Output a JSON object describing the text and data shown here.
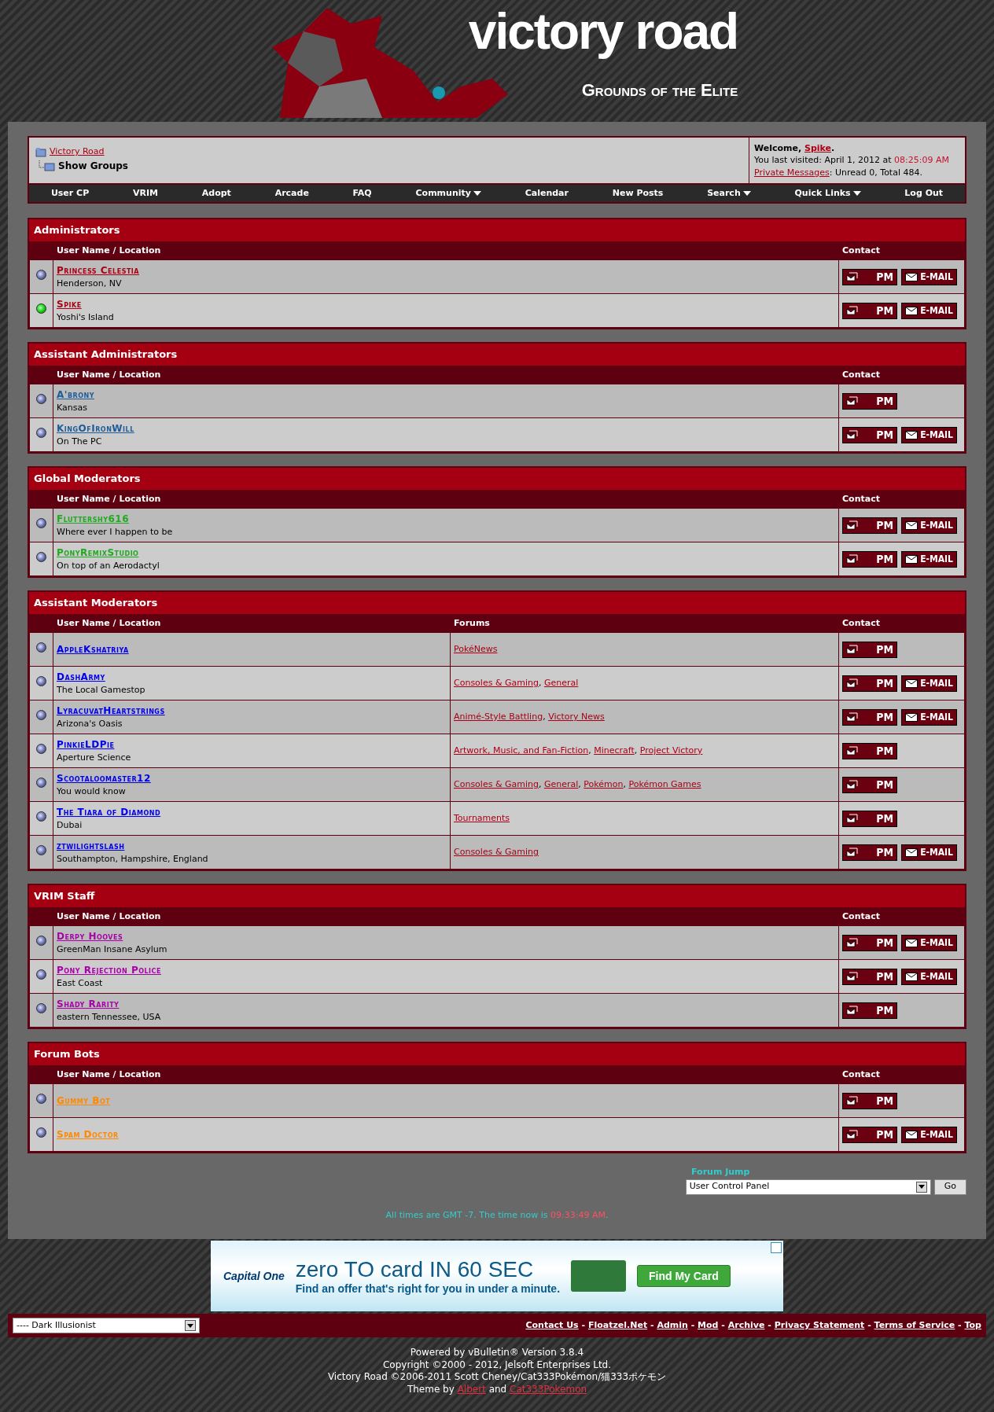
{
  "logo": {
    "title": "victory road",
    "subtitle": "Grounds of the Elite"
  },
  "breadcrumb": {
    "parent": "Victory Road",
    "current": "Show Groups"
  },
  "welcome": {
    "label": "Welcome,",
    "username": "Spike",
    "end": ".",
    "last_visited_label": "You last visited: April 1, 2012 at",
    "last_visited_time": "08:25:09 AM",
    "pm_link": "Private Messages",
    "pm_counts": ": Unread 0, Total 484."
  },
  "navbar": [
    {
      "label": "User CP",
      "menu": false
    },
    {
      "label": "VRIM",
      "menu": false
    },
    {
      "label": "Adopt",
      "menu": false
    },
    {
      "label": "Arcade",
      "menu": false
    },
    {
      "label": "FAQ",
      "menu": false
    },
    {
      "label": "Community",
      "menu": true
    },
    {
      "label": "Calendar",
      "menu": false
    },
    {
      "label": "New Posts",
      "menu": false
    },
    {
      "label": "Search",
      "menu": true
    },
    {
      "label": "Quick Links",
      "menu": true
    },
    {
      "label": "Log Out",
      "menu": false
    }
  ],
  "list_separator": ", ",
  "groups": [
    {
      "title": "Administrators",
      "color": "#aa0014",
      "columns": [
        "User Name / Location",
        "Contact"
      ],
      "members": [
        {
          "name": "Princess Celestia",
          "location": "Henderson, NV",
          "online": false,
          "contact": [
            {
              "kind": "pm",
              "label": "PM"
            },
            {
              "kind": "email",
              "label": "E-MAIL"
            }
          ]
        },
        {
          "name": "Spike",
          "location": "Yoshi's Island",
          "online": true,
          "contact": [
            {
              "kind": "pm",
              "label": "PM"
            },
            {
              "kind": "email",
              "label": "E-MAIL"
            }
          ]
        }
      ]
    },
    {
      "title": "Assistant Administrators",
      "color": "#1f5c99",
      "columns": [
        "User Name / Location",
        "Contact"
      ],
      "members": [
        {
          "name": "A'brony",
          "location": "Kansas",
          "online": false,
          "contact": [
            {
              "kind": "pm",
              "label": "PM"
            }
          ]
        },
        {
          "name": "KingOfIronWill",
          "location": "On The PC",
          "online": false,
          "contact": [
            {
              "kind": "pm",
              "label": "PM"
            },
            {
              "kind": "email",
              "label": "E-MAIL"
            }
          ]
        }
      ]
    },
    {
      "title": "Global Moderators",
      "color": "#1faa1f",
      "columns": [
        "User Name / Location",
        "Contact"
      ],
      "members": [
        {
          "name": "Fluttershy616",
          "location": "Where ever I happen to be",
          "online": false,
          "contact": [
            {
              "kind": "pm",
              "label": "PM"
            },
            {
              "kind": "email",
              "label": "E-MAIL"
            }
          ]
        },
        {
          "name": "PonyRemixStudio",
          "location": "On top of an Aerodactyl",
          "online": false,
          "contact": [
            {
              "kind": "pm",
              "label": "PM"
            },
            {
              "kind": "email",
              "label": "E-MAIL"
            }
          ]
        }
      ]
    },
    {
      "title": "Assistant Moderators",
      "color": "#0000ee",
      "columns": [
        "User Name / Location",
        "Forums",
        "Contact"
      ],
      "members": [
        {
          "name": "AppleKshatriya",
          "online": false,
          "forums": [
            "PokéNews"
          ],
          "contact": [
            {
              "kind": "pm",
              "label": "PM"
            }
          ]
        },
        {
          "name": "DashArmy",
          "location": "The Local Gamestop",
          "online": false,
          "forums": [
            "Consoles & Gaming",
            "General"
          ],
          "contact": [
            {
              "kind": "pm",
              "label": "PM"
            },
            {
              "kind": "email",
              "label": "E-MAIL"
            }
          ]
        },
        {
          "name": "LyracuvatHeartstrings",
          "location": "Arizona's Oasis",
          "online": false,
          "forums": [
            "Animé-Style Battling",
            "Victory News"
          ],
          "contact": [
            {
              "kind": "pm",
              "label": "PM"
            },
            {
              "kind": "email",
              "label": "E-MAIL"
            }
          ]
        },
        {
          "name": "PinkieLDPie",
          "location": "Aperture Science",
          "online": false,
          "forums": [
            "Artwork, Music, and Fan-Fiction",
            "Minecraft",
            "Project Victory"
          ],
          "contact": [
            {
              "kind": "pm",
              "label": "PM"
            }
          ]
        },
        {
          "name": "Scootaloomaster12",
          "location": "You would know",
          "online": false,
          "forums": [
            "Consoles & Gaming",
            "General",
            "Pokémon",
            "Pokémon Games"
          ],
          "contact": [
            {
              "kind": "pm",
              "label": "PM"
            }
          ]
        },
        {
          "name": "The Tiara of Diamond",
          "location": "Dubai",
          "online": false,
          "forums": [
            "Tournaments"
          ],
          "contact": [
            {
              "kind": "pm",
              "label": "PM"
            }
          ]
        },
        {
          "name": "ztwilightslash",
          "location": "Southampton, Hampshire, England",
          "online": false,
          "forums": [
            "Consoles & Gaming"
          ],
          "contact": [
            {
              "kind": "pm",
              "label": "PM"
            },
            {
              "kind": "email",
              "label": "E-MAIL"
            }
          ]
        }
      ]
    },
    {
      "title": "VRIM Staff",
      "color": "#aa00aa",
      "columns": [
        "User Name / Location",
        "Contact"
      ],
      "members": [
        {
          "name": "Derpy Hooves",
          "location": "GreenMan Insane Asylum",
          "online": false,
          "contact": [
            {
              "kind": "pm",
              "label": "PM"
            },
            {
              "kind": "email",
              "label": "E-MAIL"
            }
          ]
        },
        {
          "name": "Pony Rejection Police",
          "location": "East Coast",
          "online": false,
          "contact": [
            {
              "kind": "pm",
              "label": "PM"
            },
            {
              "kind": "email",
              "label": "E-MAIL"
            }
          ]
        },
        {
          "name": "Shady Rarity",
          "location": "eastern Tennessee, USA",
          "online": false,
          "contact": [
            {
              "kind": "pm",
              "label": "PM"
            }
          ]
        }
      ]
    },
    {
      "title": "Forum Bots",
      "color": "#ff8800",
      "columns": [
        "User Name / Location",
        "Contact"
      ],
      "members": [
        {
          "name": "Gummy Bot",
          "online": false,
          "contact": [
            {
              "kind": "pm",
              "label": "PM"
            }
          ]
        },
        {
          "name": "Spam Doctor",
          "online": false,
          "contact": [
            {
              "kind": "pm",
              "label": "PM"
            },
            {
              "kind": "email",
              "label": "E-MAIL"
            }
          ]
        }
      ]
    }
  ],
  "forum_jump": {
    "label": "Forum Jump",
    "value": "User Control Panel",
    "button": "Go"
  },
  "time_note": {
    "text": "All times are GMT -7. The time now is",
    "time": "09:33:49 AM",
    "end": "."
  },
  "ad": {
    "brand": "Capital One",
    "headline": "zero TO card IN 60 SEC",
    "tagline": "Find an offer that's right for you in under a minute.",
    "button": "Find My Card"
  },
  "style_select": "---- Dark Illusionist",
  "footer_separator": " - ",
  "footer_links": [
    "Contact Us",
    "Floatzel.Net",
    "Admin",
    "Mod",
    "Archive",
    "Privacy Statement",
    "Terms of Service",
    "Top"
  ],
  "copyright": [
    "Powered by vBulletin® Version 3.8.4",
    "Copyright ©2000 - 2012, Jelsoft Enterprises Ltd.",
    "Victory Road ©2006-2011 Scott Cheney/Cat333Pokémon/猫333ポケモン"
  ],
  "theme_by": {
    "label": "Theme by",
    "author_1": "Albert",
    "joiner": "and",
    "author_2": "Cat333Pokemon"
  }
}
